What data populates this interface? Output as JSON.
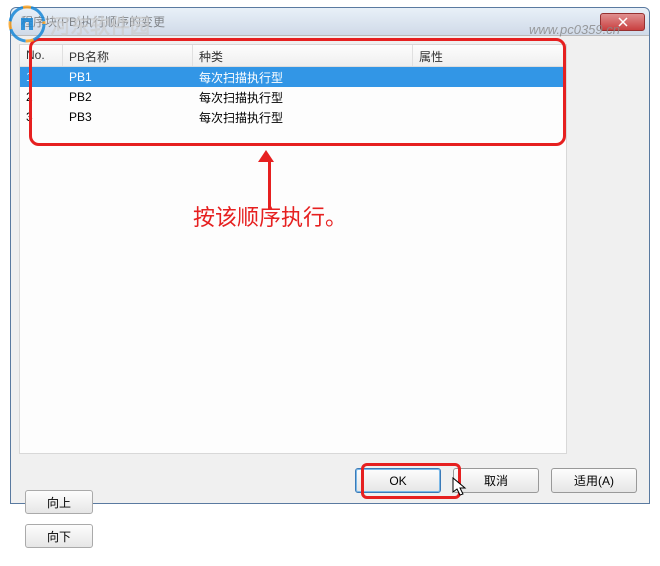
{
  "watermark": {
    "text": "河东软件园",
    "url": "www.pc0359.cn"
  },
  "window": {
    "title": "程序块(PB)执行顺序的变更"
  },
  "table": {
    "headers": {
      "no": "No.",
      "name": "PB名称",
      "type": "种类",
      "attr": "属性"
    },
    "rows": [
      {
        "no": "1",
        "name": "PB1",
        "type": "每次扫描执行型",
        "attr": "",
        "selected": true
      },
      {
        "no": "2",
        "name": "PB2",
        "type": "每次扫描执行型",
        "attr": "",
        "selected": false
      },
      {
        "no": "3",
        "name": "PB3",
        "type": "每次扫描执行型",
        "attr": "",
        "selected": false
      }
    ]
  },
  "annotation": "按该顺序执行。",
  "buttons": {
    "up": "向上",
    "down": "向下",
    "ok": "OK",
    "cancel": "取消",
    "apply": "适用(A)"
  }
}
